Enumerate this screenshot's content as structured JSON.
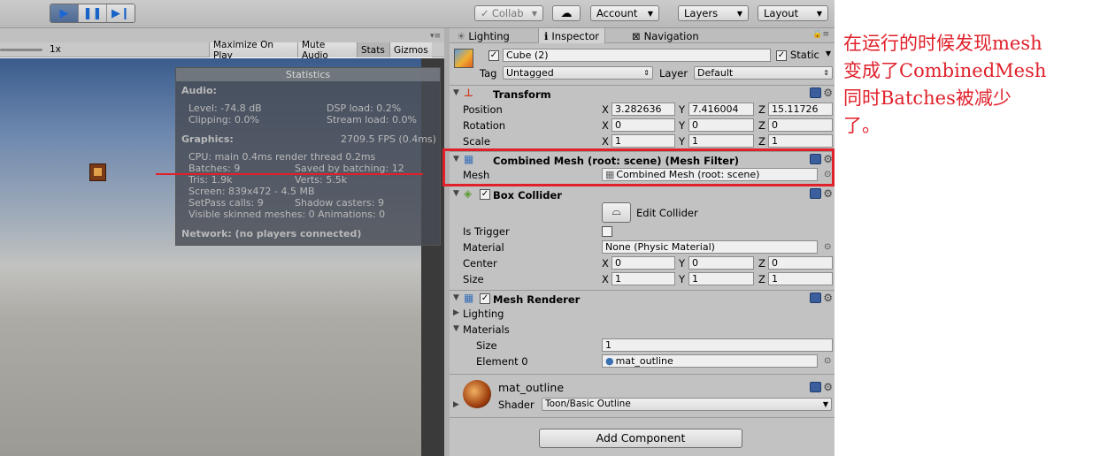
{
  "toolbar": {
    "play_icon": "play-icon",
    "pause_icon": "pause-icon",
    "step_icon": "step-icon",
    "collab": "Collab",
    "cloud_icon": "cloud-icon",
    "account": "Account",
    "layers": "Layers",
    "layout": "Layout"
  },
  "game": {
    "scale_label": "1x",
    "tabs": [
      "Maximize On Play",
      "Mute Audio",
      "Stats",
      "Gizmos"
    ],
    "stats": {
      "title": "Statistics",
      "audio_header": "Audio:",
      "level": "Level: -74.8 dB",
      "clipping": "Clipping: 0.0%",
      "dsp": "DSP load: 0.2%",
      "stream": "Stream load: 0.0%",
      "graphics_header": "Graphics:",
      "fps": "2709.5 FPS (0.4ms)",
      "cpu": "CPU: main 0.4ms  render thread 0.2ms",
      "batches": "Batches: 9",
      "saved": "Saved by batching: 12",
      "tris": "Tris: 1.9k",
      "verts": "Verts: 5.5k",
      "screen": "Screen: 839x472 - 4.5 MB",
      "setpass": "SetPass calls: 9",
      "shadow": "Shadow casters: 9",
      "skinned": "Visible skinned meshes: 0  Animations: 0",
      "network": "Network: (no players connected)"
    }
  },
  "inspector": {
    "tabs": [
      "Lighting",
      "Inspector",
      "Navigation"
    ],
    "object_name": "Cube (2)",
    "static_label": "Static",
    "tag_label": "Tag",
    "tag_value": "Untagged",
    "layer_label": "Layer",
    "layer_value": "Default",
    "transform": {
      "title": "Transform",
      "position_label": "Position",
      "rotation_label": "Rotation",
      "scale_label": "Scale",
      "position": [
        "3.282636",
        "7.416004",
        "15.11726"
      ],
      "rotation": [
        "0",
        "0",
        "0"
      ],
      "scale": [
        "1",
        "1",
        "1"
      ]
    },
    "mesh_filter": {
      "title": "Combined Mesh (root: scene) (Mesh Filter)",
      "mesh_label": "Mesh",
      "mesh_value": "Combined Mesh (root: scene)"
    },
    "box_collider": {
      "title": "Box Collider",
      "edit_label": "Edit Collider",
      "is_trigger_label": "Is Trigger",
      "material_label": "Material",
      "material_value": "None (Physic Material)",
      "center_label": "Center",
      "center": [
        "0",
        "0",
        "0"
      ],
      "size_label": "Size",
      "size": [
        "1",
        "1",
        "1"
      ]
    },
    "mesh_renderer": {
      "title": "Mesh Renderer",
      "lighting_label": "Lighting",
      "materials_label": "Materials",
      "size_label": "Size",
      "size_value": "1",
      "element_label": "Element 0",
      "element_value": "mat_outline"
    },
    "material": {
      "name": "mat_outline",
      "shader_label": "Shader",
      "shader_value": "Toon/Basic Outline"
    },
    "add_component": "Add Component"
  },
  "annotation": "在运行的时候发现mesh\n变成了CombinedMesh\n同时Batches被减少\n了。",
  "colors": {
    "highlight": "#e0202a"
  }
}
